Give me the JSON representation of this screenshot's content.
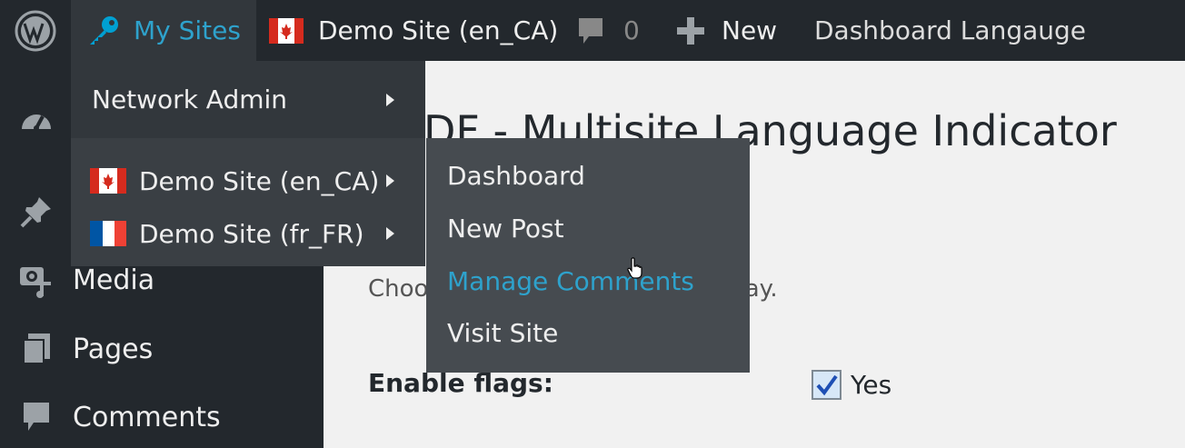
{
  "admin_bar": {
    "wp_logo_icon": "wordpress-logo-icon",
    "my_sites_label": "My Sites",
    "site_label": "Demo Site (en_CA)",
    "comments_count": "0",
    "new_label": "New",
    "language_label": "Dashboard Langauge"
  },
  "my_sites_menu": {
    "network_admin": "Network Admin",
    "sites": [
      {
        "label": "Demo Site (en_CA)",
        "flag": "canada"
      },
      {
        "label": "Demo Site (fr_FR)",
        "flag": "france"
      }
    ],
    "submenu": [
      {
        "label": "Dashboard"
      },
      {
        "label": "New Post"
      },
      {
        "label": "Manage Comments"
      },
      {
        "label": "Visit Site"
      }
    ]
  },
  "sidebar": {
    "items": [
      {
        "icon": "dashboard-icon",
        "label": ""
      },
      {
        "icon": "pin-icon",
        "label": ""
      },
      {
        "icon": "media-icon",
        "label": "Media"
      },
      {
        "icon": "pages-icon",
        "label": "Pages"
      },
      {
        "icon": "comments-icon",
        "label": "Comments"
      }
    ]
  },
  "main": {
    "title_visible": "DF - Multisite Language Indicator",
    "description_left": "Choo",
    "description_right": "splay.",
    "enable_flags_label": "Enable flags:",
    "enable_flags_value": "Yes"
  },
  "colors": {
    "admin_bar": "#23282d",
    "accent": "#2ea2cc",
    "submenu": "#464b50"
  }
}
